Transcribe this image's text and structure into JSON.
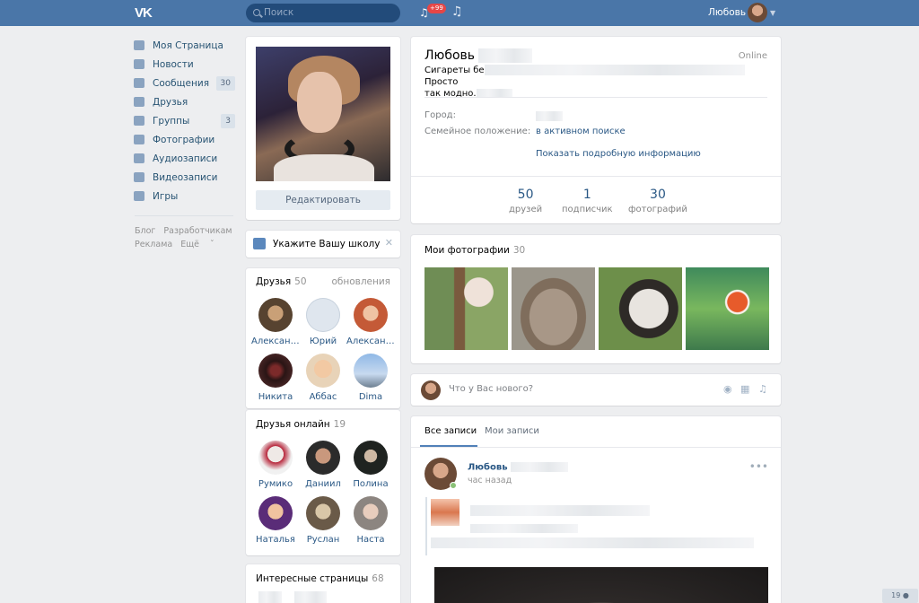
{
  "header": {
    "logo": "VK",
    "search_placeholder": "Поиск",
    "notifications_badge": "+99",
    "user_name": "Любовь"
  },
  "left_nav": {
    "items": [
      {
        "label": "Моя Страница",
        "icon": "home-icon",
        "count": ""
      },
      {
        "label": "Новости",
        "icon": "news-icon",
        "count": ""
      },
      {
        "label": "Сообщения",
        "icon": "messages-icon",
        "count": "30"
      },
      {
        "label": "Друзья",
        "icon": "friends-icon",
        "count": ""
      },
      {
        "label": "Группы",
        "icon": "groups-icon",
        "count": "3"
      },
      {
        "label": "Фотографии",
        "icon": "camera-icon",
        "count": ""
      },
      {
        "label": "Аудиозаписи",
        "icon": "music-icon",
        "count": ""
      },
      {
        "label": "Видеозаписи",
        "icon": "video-icon",
        "count": ""
      },
      {
        "label": "Игры",
        "icon": "gamepad-icon",
        "count": ""
      }
    ],
    "footer_links": [
      "Блог",
      "Разработчикам",
      "Реклама",
      "Ещё"
    ]
  },
  "profile_card": {
    "edit_label": "Редактировать"
  },
  "school_prompt": {
    "text": "Укажите Вашу школу"
  },
  "friends": {
    "title": "Друзья",
    "count": "50",
    "updates_label": "обновления",
    "items": [
      "Александр",
      "Юрий",
      "Александ…",
      "Никита",
      "Аббас",
      "Dima"
    ]
  },
  "friends_online": {
    "title": "Друзья онлайн",
    "count": "19",
    "items": [
      "Румико",
      "Даниил",
      "Полина",
      "Наталья",
      "Руслан",
      "Наста"
    ]
  },
  "interesting_pages": {
    "title": "Интересные страницы",
    "count": "68"
  },
  "profile": {
    "name": "Любовь",
    "online_label": "Online",
    "status_start": "Сигареты бе",
    "status_end": "Просто",
    "status_line2": "так модно.",
    "city_label": "Город:",
    "family_label": "Семейное положение:",
    "family_value": "в активном поиске",
    "show_more": "Показать подробную информацию",
    "stats": [
      {
        "value": "50",
        "label": "друзей"
      },
      {
        "value": "1",
        "label": "подписчик"
      },
      {
        "value": "30",
        "label": "фотографий"
      }
    ]
  },
  "my_photos": {
    "title": "Мои фотографии",
    "count": "30"
  },
  "new_post": {
    "placeholder": "Что у Вас нового?"
  },
  "wall": {
    "tabs": [
      "Все записи",
      "Мои записи"
    ],
    "post": {
      "author": "Любовь",
      "time": "час назад"
    }
  },
  "right_corner_badge": "19"
}
